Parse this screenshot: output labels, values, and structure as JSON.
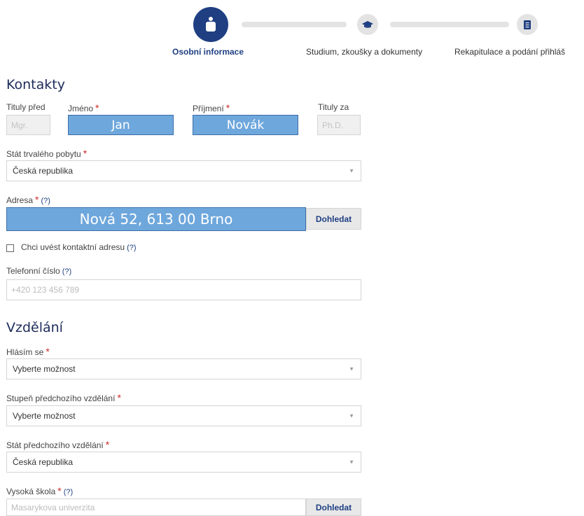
{
  "stepper": {
    "steps": [
      {
        "label": "Osobní informace",
        "icon": "person-icon",
        "active": true
      },
      {
        "label": "Studium, zkoušky a dokumenty",
        "icon": "graduation-cap-icon",
        "active": false
      },
      {
        "label": "Rekapitulace a podání přihláš",
        "icon": "document-icon",
        "active": false
      }
    ]
  },
  "colors": {
    "accent": "#1f3f82",
    "highlight": "#6ea7dc",
    "required": "#cc2b2b"
  },
  "contacts": {
    "title": "Kontakty",
    "titles_before": {
      "label": "Tituly před",
      "placeholder": "Mgr."
    },
    "first_name": {
      "label": "Jméno",
      "required": "*",
      "value": "Jan"
    },
    "last_name": {
      "label": "Příjmení",
      "required": "*",
      "value": "Novák"
    },
    "titles_after": {
      "label": "Tituly za",
      "placeholder": "Ph.D."
    },
    "country": {
      "label": "Stát trvalého pobytu",
      "required": "*",
      "value": "Česká republika"
    },
    "address": {
      "label": "Adresa",
      "required": "*",
      "help": "(?)",
      "value": "Nová 52, 613 00 Brno",
      "button": "Dohledat"
    },
    "contact_address": {
      "label": "Chci uvést kontaktní adresu",
      "help": "(?)"
    },
    "phone": {
      "label": "Telefonní číslo",
      "help": "(?)",
      "placeholder": "+420 123 456 789"
    }
  },
  "education": {
    "title": "Vzdělání",
    "applying": {
      "label": "Hlásím se",
      "required": "*",
      "value": "Vyberte možnost"
    },
    "prev_level": {
      "label": "Stupeň předchozího vzdělání",
      "required": "*",
      "value": "Vyberte možnost"
    },
    "prev_country": {
      "label": "Stát předchozího vzdělání",
      "required": "*",
      "value": "Česká republika"
    },
    "university": {
      "label": "Vysoká škola",
      "required": "*",
      "help": "(?)",
      "placeholder": "Masarykova univerzita",
      "button": "Dohledat"
    }
  }
}
